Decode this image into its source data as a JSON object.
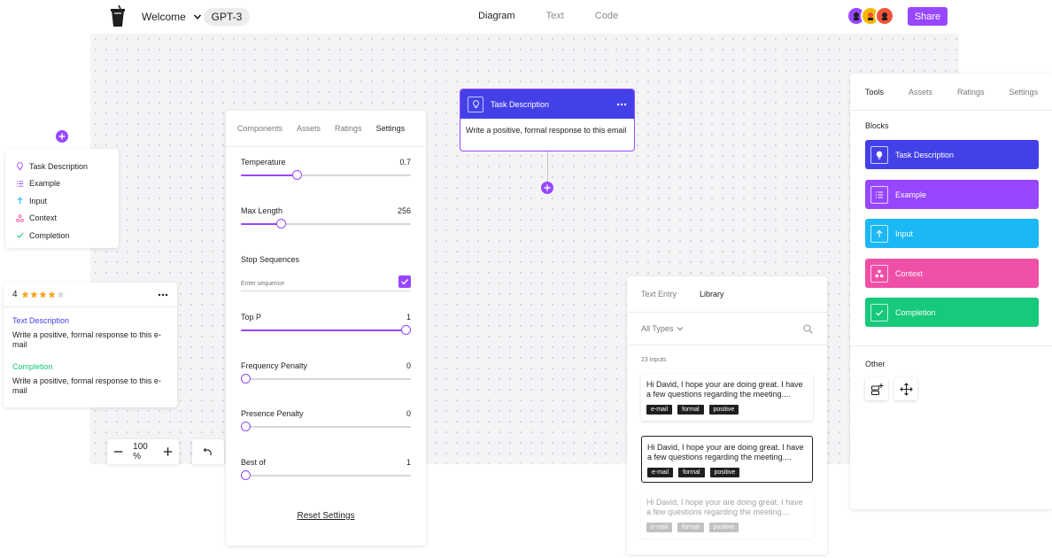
{
  "topbar": {
    "project_name": "Welcome",
    "model": "GPT-3",
    "view_tabs": [
      "Diagram",
      "Text",
      "Code"
    ],
    "active_view": "Diagram",
    "share_label": "Share",
    "avatar_colors": [
      "#9747ff",
      "#f5b700",
      "#f2533a"
    ]
  },
  "block_menu": {
    "items": [
      {
        "label": "Task Description",
        "icon": "lightbulb-icon",
        "color": "#9747ff"
      },
      {
        "label": "Example",
        "icon": "list-icon",
        "color": "#9747ff"
      },
      {
        "label": "Input",
        "icon": "arrow-up-icon",
        "color": "#1bb8f5"
      },
      {
        "label": "Context",
        "icon": "nodes-icon",
        "color": "#f04fa8"
      },
      {
        "label": "Completion",
        "icon": "check-icon",
        "color": "#17c97a"
      }
    ]
  },
  "rating_card": {
    "rating": "4",
    "stars_filled": 4,
    "stars_total": 5,
    "sections": [
      {
        "title": "Text Description",
        "title_color": "#4340e8",
        "text": "Write a positive, formal response to this e-mail"
      },
      {
        "title": "Completion",
        "title_color": "#17c97a",
        "text": "Write a positive, formal response to this e-mail"
      }
    ]
  },
  "zoom": {
    "value": "100 %"
  },
  "settings_panel": {
    "tabs": [
      "Components",
      "Assets",
      "Ratings",
      "Settings"
    ],
    "active_tab": "Settings",
    "params": [
      {
        "label": "Temperature",
        "value": "0.7",
        "fraction": 0.32
      },
      {
        "label": "Max Length",
        "value": "256",
        "fraction": 0.22
      },
      {
        "label": "Top P",
        "value": "1",
        "fraction": 1.0
      },
      {
        "label": "Frequency Penalty",
        "value": "0",
        "fraction": 0.0
      },
      {
        "label": "Presence Penalty",
        "value": "0",
        "fraction": 0.0
      },
      {
        "label": "Best of",
        "value": "1",
        "fraction": 0.0
      }
    ],
    "stop_sequences_label": "Stop Sequences",
    "stop_sequences_placeholder": "Enter sequence",
    "stop_sequences_checked": true,
    "reset_label": "Reset Settings"
  },
  "task_node": {
    "title": "Task Description",
    "text": "Write a positive, formal response to this email"
  },
  "library_panel": {
    "tabs": [
      "Text Entry",
      "Library"
    ],
    "active_tab": "Library",
    "filter_label": "All Types",
    "count_label": "23 inputs",
    "entries": [
      {
        "text": "Hi David, I hope your are doing great. I have a few questions regarding the meeting....",
        "tags": [
          "e-mail",
          "formal",
          "positive"
        ],
        "state": "normal"
      },
      {
        "text": "Hi David, I hope your are doing great. I have a few questions regarding the meeting....",
        "tags": [
          "e-mail",
          "formal",
          "positive"
        ],
        "state": "selected"
      },
      {
        "text": "Hi David, I hope your are doing great. I have a few questions regarding the meeting....",
        "tags": [
          "e-mail",
          "formal",
          "positive"
        ],
        "state": "faded"
      }
    ]
  },
  "tools_panel": {
    "tabs": [
      "Tools",
      "Assets",
      "Ratings",
      "Settings"
    ],
    "active_tab": "Tools",
    "blocks_label": "Blocks",
    "blocks": [
      {
        "label": "Task Description",
        "color": "#4340e8",
        "icon": "lightbulb-icon"
      },
      {
        "label": "Example",
        "color": "#9747ff",
        "icon": "list-icon"
      },
      {
        "label": "Input",
        "color": "#1bb8f5",
        "icon": "arrow-up-icon"
      },
      {
        "label": "Context",
        "color": "#f04fa8",
        "icon": "nodes-icon"
      },
      {
        "label": "Completion",
        "color": "#17c97a",
        "icon": "check-icon"
      }
    ],
    "other_label": "Other",
    "other_tools": [
      "add-block-icon",
      "move-icon"
    ]
  }
}
